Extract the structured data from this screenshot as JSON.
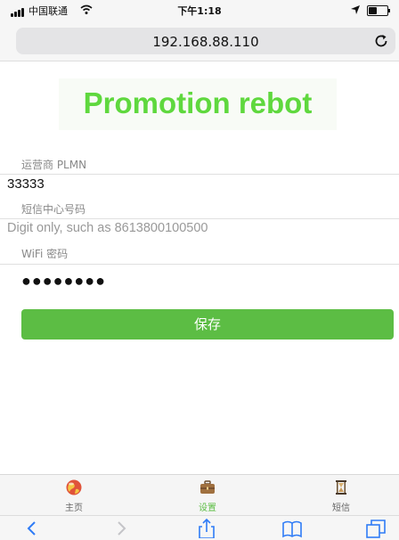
{
  "status_bar": {
    "carrier": "中国联通",
    "time": "下午1:18"
  },
  "address_bar": {
    "url": "192.168.88.110"
  },
  "banner": {
    "title": "Promotion rebot"
  },
  "form": {
    "plmn": {
      "label": "运营商 PLMN",
      "value": "33333"
    },
    "sms_center": {
      "label": "短信中心号码",
      "value": "",
      "placeholder": "Digit only, such as 8613800100500"
    },
    "wifi_password": {
      "label": "WiFi 密码",
      "value": "●●●●●●●●"
    },
    "save_label": "保存"
  },
  "tabs": [
    {
      "label": "主页",
      "icon": "globe-icon",
      "active": false
    },
    {
      "label": "设置",
      "icon": "briefcase-icon",
      "active": true
    },
    {
      "label": "短信",
      "icon": "hourglass-icon",
      "active": false
    }
  ],
  "colors": {
    "accent_green": "#5cbd44",
    "banner_green": "#5fd83e",
    "ios_blue": "#2f7cf6"
  }
}
